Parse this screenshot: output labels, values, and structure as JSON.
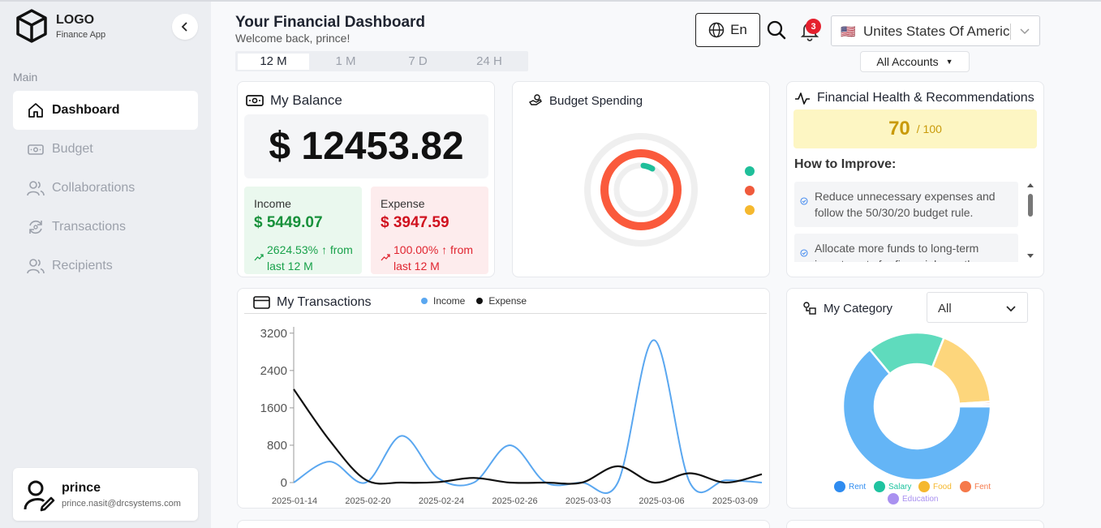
{
  "app": {
    "logo_title": "LOGO",
    "logo_sub": "Finance App"
  },
  "sidebar": {
    "section": "Main",
    "items": [
      {
        "label": "Dashboard",
        "icon": "home-icon",
        "active": true
      },
      {
        "label": "Budget",
        "icon": "wallet-icon"
      },
      {
        "label": "Collaborations",
        "icon": "users-icon"
      },
      {
        "label": "Transactions",
        "icon": "exchange-icon"
      },
      {
        "label": "Recipients",
        "icon": "users-icon"
      }
    ]
  },
  "user": {
    "name": "prince",
    "email": "prince.nasit@drcsystems.com"
  },
  "header": {
    "title": "Your Financial Dashboard",
    "subtitle": "Welcome back, prince!",
    "ranges": [
      "12 M",
      "1 M",
      "7 D",
      "24 H"
    ],
    "active_range": "12 M",
    "language": "En",
    "notifications": "3",
    "country_flag": "🇺🇸",
    "country": "Unites States Of Americ",
    "accounts": "All Accounts"
  },
  "balance": {
    "title": "My Balance",
    "amount": "$ 12453.82",
    "income_label": "Income",
    "income_value": "$ 5449.07",
    "income_change": "2624.53% ↑ from last 12 M",
    "expense_label": "Expense",
    "expense_value": "$ 3947.59",
    "expense_change": "100.00% ↑ from last 12 M"
  },
  "budget": {
    "title": "Budget Spending",
    "legend_colors": [
      "#1fbf9a",
      "#f05a3c",
      "#f5b82e"
    ],
    "ring_color": "#fa5a3c",
    "inner_arc_color": "#1fbf9a"
  },
  "health": {
    "title": "Financial Health & Recommendations",
    "score": "70",
    "score_max": "/ 100",
    "improve_title": "How to Improve:",
    "recommendations": [
      "Reduce unnecessary expenses and follow the 50/30/20 budget rule.",
      "Allocate more funds to long-term investments for financial growth."
    ]
  },
  "transactions": {
    "title": "My Transactions",
    "legend": [
      "Income",
      "Expense"
    ]
  },
  "category": {
    "title": "My Category",
    "filter": "All",
    "legend": [
      {
        "label": "Rent",
        "color": "#2f8cf0"
      },
      {
        "label": "Salary",
        "color": "#1fc3a0"
      },
      {
        "label": "Food",
        "color": "#f5b82e"
      },
      {
        "label": "Fent",
        "color": "#f5794a"
      },
      {
        "label": "Education",
        "color": "#a991f0"
      }
    ]
  },
  "chart_data": [
    {
      "type": "line",
      "x": [
        "2025-01-14",
        "",
        "2025-02-20",
        "",
        "2025-02-24",
        "",
        "2025-02-26",
        "",
        "2025-03-03",
        "",
        "2025-03-06",
        "",
        "2025-03-09"
      ],
      "x_ticks": [
        "2025-01-14",
        "2025-02-20",
        "2025-02-24",
        "2025-02-26",
        "2025-03-03",
        "2025-03-06",
        "2025-03-09"
      ],
      "series": [
        {
          "name": "Income",
          "color": "#5aa7f0",
          "values": [
            0,
            450,
            0,
            1000,
            100,
            0,
            800,
            0,
            0,
            0,
            3050,
            0,
            50,
            0
          ]
        },
        {
          "name": "Expense",
          "color": "#111111",
          "values": [
            2000,
            900,
            60,
            0,
            10,
            100,
            0,
            0,
            0,
            350,
            0,
            200,
            0,
            180
          ]
        }
      ],
      "y_ticks": [
        0,
        800,
        1600,
        2400,
        3200
      ],
      "ylim": [
        0,
        3300
      ]
    },
    {
      "type": "pie",
      "categories": [
        "Rent",
        "Salary",
        "Food",
        "Fent",
        "Education"
      ],
      "values": [
        64,
        17,
        18,
        0.5,
        0.5
      ],
      "colors": [
        "#64b5f6",
        "#5fdbbd",
        "#fdd67c",
        "#f5a58a",
        "#c7b6f5"
      ]
    }
  ]
}
